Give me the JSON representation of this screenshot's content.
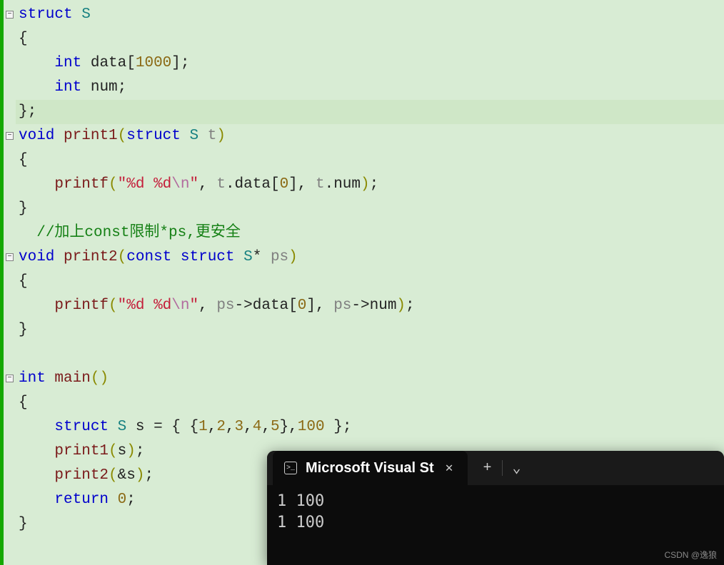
{
  "code": {
    "lines": [
      {
        "id": 1,
        "tokens": [
          {
            "t": "struct",
            "c": "kw"
          },
          {
            "t": " "
          },
          {
            "t": "S",
            "c": "type"
          }
        ]
      },
      {
        "id": 2,
        "tokens": [
          {
            "t": "{"
          }
        ]
      },
      {
        "id": 3,
        "tokens": [
          {
            "t": "    "
          },
          {
            "t": "int",
            "c": "kw"
          },
          {
            "t": " data["
          },
          {
            "t": "1000",
            "c": "num"
          },
          {
            "t": "];"
          }
        ]
      },
      {
        "id": 4,
        "tokens": [
          {
            "t": "    "
          },
          {
            "t": "int",
            "c": "kw"
          },
          {
            "t": " num;"
          }
        ]
      },
      {
        "id": 5,
        "hl": true,
        "tokens": [
          {
            "t": "};"
          }
        ]
      },
      {
        "id": 6,
        "tokens": [
          {
            "t": "void",
            "c": "kw"
          },
          {
            "t": " "
          },
          {
            "t": "print1",
            "c": "func"
          },
          {
            "t": "(",
            "c": "paren"
          },
          {
            "t": "struct",
            "c": "kw"
          },
          {
            "t": " "
          },
          {
            "t": "S",
            "c": "type"
          },
          {
            "t": " "
          },
          {
            "t": "t",
            "c": "param"
          },
          {
            "t": ")",
            "c": "paren"
          }
        ]
      },
      {
        "id": 7,
        "tokens": [
          {
            "t": "{"
          }
        ]
      },
      {
        "id": 8,
        "tokens": [
          {
            "t": "    "
          },
          {
            "t": "printf",
            "c": "func"
          },
          {
            "t": "(",
            "c": "paren"
          },
          {
            "t": "\"%d %d",
            "c": "str"
          },
          {
            "t": "\\n",
            "c": "esc"
          },
          {
            "t": "\"",
            "c": "str"
          },
          {
            "t": ", "
          },
          {
            "t": "t",
            "c": "param"
          },
          {
            "t": ".data["
          },
          {
            "t": "0",
            "c": "num"
          },
          {
            "t": "], "
          },
          {
            "t": "t",
            "c": "param"
          },
          {
            "t": ".num"
          },
          {
            "t": ")",
            "c": "paren"
          },
          {
            "t": ";"
          }
        ]
      },
      {
        "id": 9,
        "tokens": [
          {
            "t": "}"
          }
        ]
      },
      {
        "id": 10,
        "tokens": [
          {
            "t": "  "
          },
          {
            "t": "//加上const限制*ps,更安全",
            "c": "comment"
          }
        ]
      },
      {
        "id": 11,
        "tokens": [
          {
            "t": "void",
            "c": "kw"
          },
          {
            "t": " "
          },
          {
            "t": "print2",
            "c": "func"
          },
          {
            "t": "(",
            "c": "paren"
          },
          {
            "t": "const",
            "c": "kw"
          },
          {
            "t": " "
          },
          {
            "t": "struct",
            "c": "kw"
          },
          {
            "t": " "
          },
          {
            "t": "S",
            "c": "type"
          },
          {
            "t": "* "
          },
          {
            "t": "ps",
            "c": "param"
          },
          {
            "t": ")",
            "c": "paren"
          }
        ]
      },
      {
        "id": 12,
        "tokens": [
          {
            "t": "{"
          }
        ]
      },
      {
        "id": 13,
        "tokens": [
          {
            "t": "    "
          },
          {
            "t": "printf",
            "c": "func"
          },
          {
            "t": "(",
            "c": "paren"
          },
          {
            "t": "\"%d %d",
            "c": "str"
          },
          {
            "t": "\\n",
            "c": "esc"
          },
          {
            "t": "\"",
            "c": "str"
          },
          {
            "t": ", "
          },
          {
            "t": "ps",
            "c": "param"
          },
          {
            "t": "->data["
          },
          {
            "t": "0",
            "c": "num"
          },
          {
            "t": "], "
          },
          {
            "t": "ps",
            "c": "param"
          },
          {
            "t": "->num"
          },
          {
            "t": ")",
            "c": "paren"
          },
          {
            "t": ";"
          }
        ]
      },
      {
        "id": 14,
        "tokens": [
          {
            "t": "}"
          }
        ]
      },
      {
        "id": 15,
        "tokens": [
          {
            "t": " "
          }
        ]
      },
      {
        "id": 16,
        "tokens": [
          {
            "t": "int",
            "c": "kw"
          },
          {
            "t": " "
          },
          {
            "t": "main",
            "c": "func"
          },
          {
            "t": "()",
            "c": "paren"
          }
        ]
      },
      {
        "id": 17,
        "tokens": [
          {
            "t": "{"
          }
        ]
      },
      {
        "id": 18,
        "tokens": [
          {
            "t": "    "
          },
          {
            "t": "struct",
            "c": "kw"
          },
          {
            "t": " "
          },
          {
            "t": "S",
            "c": "type"
          },
          {
            "t": " s = { {"
          },
          {
            "t": "1",
            "c": "num"
          },
          {
            "t": ","
          },
          {
            "t": "2",
            "c": "num"
          },
          {
            "t": ","
          },
          {
            "t": "3",
            "c": "num"
          },
          {
            "t": ","
          },
          {
            "t": "4",
            "c": "num"
          },
          {
            "t": ","
          },
          {
            "t": "5",
            "c": "num"
          },
          {
            "t": "},"
          },
          {
            "t": "100",
            "c": "num"
          },
          {
            "t": " };"
          }
        ]
      },
      {
        "id": 19,
        "tokens": [
          {
            "t": "    "
          },
          {
            "t": "print1",
            "c": "func"
          },
          {
            "t": "(",
            "c": "paren"
          },
          {
            "t": "s"
          },
          {
            "t": ")",
            "c": "paren"
          },
          {
            "t": ";"
          }
        ]
      },
      {
        "id": 20,
        "tokens": [
          {
            "t": "    "
          },
          {
            "t": "print2",
            "c": "func"
          },
          {
            "t": "(",
            "c": "paren"
          },
          {
            "t": "&s"
          },
          {
            "t": ")",
            "c": "paren"
          },
          {
            "t": ";"
          }
        ]
      },
      {
        "id": 21,
        "tokens": [
          {
            "t": "    "
          },
          {
            "t": "return",
            "c": "kw"
          },
          {
            "t": " "
          },
          {
            "t": "0",
            "c": "num"
          },
          {
            "t": ";"
          }
        ]
      },
      {
        "id": 22,
        "tokens": [
          {
            "t": "}"
          }
        ]
      }
    ],
    "fold_markers": [
      1,
      6,
      11,
      16
    ]
  },
  "terminal": {
    "tab_title": "Microsoft Visual St",
    "output_lines": [
      "1 100",
      "1 100"
    ]
  },
  "watermark": "CSDN @逸狼"
}
